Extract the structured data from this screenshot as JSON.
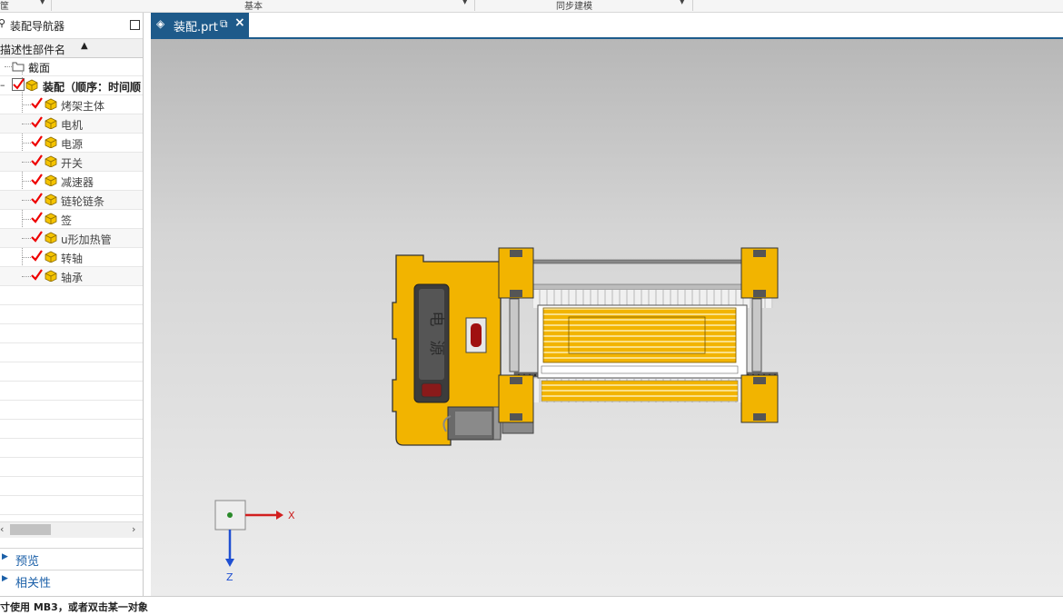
{
  "toolbar": {
    "group1": "筐",
    "group2": "基本",
    "group3": "同步建模"
  },
  "navigator": {
    "title": "装配导航器",
    "column_header": "描述性部件名",
    "section_node": "截面",
    "root_node": "装配（顺序：时间顺",
    "components": [
      "烤架主体",
      "电机",
      "电源",
      "开关",
      "减速器",
      "链轮链条",
      "签",
      "u形加热管",
      "转轴",
      "轴承"
    ],
    "preview_label": "预览",
    "dependencies_label": "相关性"
  },
  "tab": {
    "title": "装配.prt",
    "active_color": "#1e5a8a"
  },
  "model": {
    "power_label": "电源",
    "accent_color": "#f2b400"
  },
  "triad": {
    "x_label": "X",
    "z_label": "Z"
  },
  "status_bar": {
    "prompt": "寸使用 MB3，或者双击某一对象"
  }
}
